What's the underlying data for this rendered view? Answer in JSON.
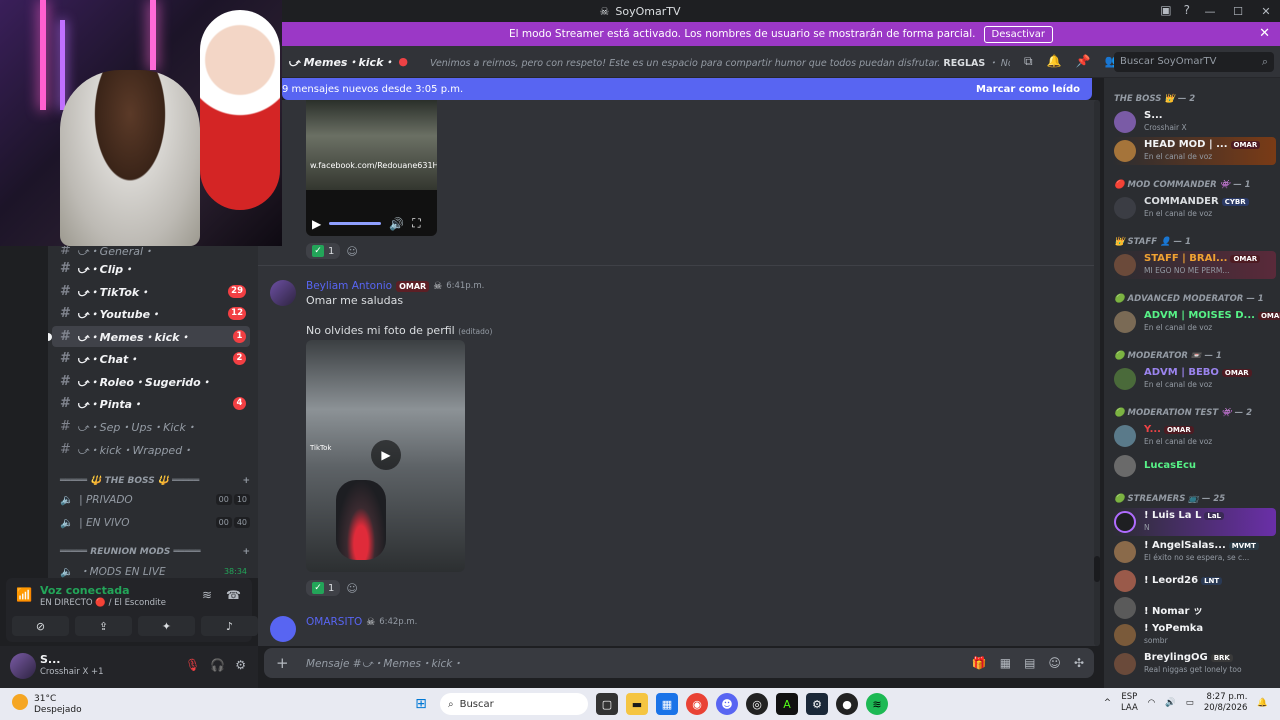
{
  "titlebar": {
    "title": "SoyOmarTV"
  },
  "banner": {
    "text": "El modo Streamer está activado. Los nombres de usuario se mostrarán de forma parcial.",
    "button": "Desactivar"
  },
  "channel": {
    "name": "⤻ Memes・kick・",
    "topic": "Venimos a reirnos, pero con respeto! Este es un espacio para compartir humor que todos puedan disfrutar.",
    "topic_bold": "REGLAS",
    "topic_tail": "・ No envíes memes que ...",
    "search_placeholder": "Buscar SoyOmarTV"
  },
  "newbar": {
    "text": "9 mensajes nuevos desde 3:05 p.m.",
    "action": "Marcar como leído"
  },
  "sidebar": {
    "channels": [
      {
        "label": "⤻・General・",
        "badge": "",
        "style": "muted"
      },
      {
        "label": "⤻・Clip・",
        "badge": "",
        "style": "bold"
      },
      {
        "label": "⤻・TikTok・",
        "badge": "29",
        "style": "bold"
      },
      {
        "label": "⤻・Youtube・",
        "badge": "12",
        "style": "bold"
      },
      {
        "label": "⤻・Memes・kick・",
        "badge": "1",
        "style": "selected"
      },
      {
        "label": "⤻・Chat・",
        "badge": "2",
        "style": "bold"
      },
      {
        "label": "⤻・Roleo・Sugerido・",
        "badge": "",
        "style": "bold"
      },
      {
        "label": "⤻・Pinta・",
        "badge": "4",
        "style": "bold"
      },
      {
        "label": "⤻・Sep・Ups・Kick・",
        "badge": "",
        "style": "muted"
      },
      {
        "label": "⤻・kick・Wrapped・",
        "badge": "",
        "style": "muted"
      }
    ],
    "category_boss": "═════ 🔱 THE BOSS 🔱 ═════",
    "voice_boss": [
      {
        "label": "| PRIVADO",
        "a": "00",
        "b": "10"
      },
      {
        "label": "| EN VIVO",
        "a": "00",
        "b": "40"
      }
    ],
    "category_reunion": "═════ REUNION MODS ═════",
    "voice_reunion": {
      "label": "・MODS EN LIVE",
      "time": "38:34"
    }
  },
  "voice_panel": {
    "status": "Voz conectada",
    "sub": "EN DIRECTO 🔴 / El Escondite"
  },
  "user_panel": {
    "name": "S...",
    "status": "Crosshair X +1"
  },
  "messages": {
    "m1_reactions": {
      "count": "1"
    },
    "m1_url": "w.facebook.com/Redouane631H",
    "m2": {
      "author": "Beyliam Antonio",
      "tag": "OMAR",
      "time": "6:41p.m.",
      "line1": "Omar me saludas",
      "line2": "No olvides mi foto de perfil",
      "edited": "(editado)",
      "video_label": "TikTok"
    },
    "m2_reactions": {
      "count": "1"
    },
    "m3": {
      "author": "OMARSITO",
      "time": "6:42p.m."
    }
  },
  "input": {
    "placeholder": "Mensaje #⤻・Memes・kick・"
  },
  "members": {
    "groups": [
      {
        "title": "THE BOSS 👑 — 2"
      },
      {
        "title": "🔴 MOD COMMANDER 👾 — 1"
      },
      {
        "title": "👑 STAFF 👤 — 1"
      },
      {
        "title": "🟢 ADVANCED MODERATOR — 1"
      },
      {
        "title": "🟢 MODERATOR 📼 — 1"
      },
      {
        "title": "🟢 MODERATION TEST 👾 — 2"
      },
      {
        "title": "🟢 STREAMERS 📺 — 25"
      }
    ],
    "list": [
      {
        "name": "S...",
        "sub": "Crosshair X",
        "tag": "",
        "color": "#f2f3f5"
      },
      {
        "name": "HEAD MOD | ...",
        "sub": "En el canal de voz",
        "tag": "OMAR",
        "color": "#f2f3f5"
      },
      {
        "name": "COMMANDER",
        "sub": "En el canal de voz",
        "tag": "CYBR",
        "color": "#dbdee1"
      },
      {
        "name": "STAFF | BRAI...",
        "sub": "MI EGO NO ME PERM...",
        "tag": "OMAR",
        "color": "#f0a232"
      },
      {
        "name": "ADVM | MOISES D...",
        "sub": "En el canal de voz",
        "tag": "OMAR",
        "color": "#57f287"
      },
      {
        "name": "ADVM | BEBO",
        "sub": "En el canal de voz",
        "tag": "OMAR",
        "color": "#9b84ee"
      },
      {
        "name": "Y...",
        "sub": "En el canal de voz",
        "tag": "OMAR",
        "color": "#ed4245"
      },
      {
        "name": "LucasEcu",
        "sub": "",
        "tag": "",
        "color": "#57f287"
      },
      {
        "name": "! Luis La L",
        "sub": "N",
        "tag": "LaL",
        "color": "#f2f3f5"
      },
      {
        "name": "! AngelSalas...",
        "sub": "El éxito no se espera, se c...",
        "tag": "MVMT",
        "color": "#f2f3f5"
      },
      {
        "name": "! Leord26",
        "sub": "",
        "tag": "LNT",
        "color": "#f2f3f5"
      },
      {
        "name": "! Nomar ッ",
        "sub": "",
        "tag": "",
        "color": "#f2f3f5"
      },
      {
        "name": "! YoPemka",
        "sub": "sombr",
        "tag": "",
        "color": "#f2f3f5"
      },
      {
        "name": "BreylingOG",
        "sub": "Real niggas get lonely too",
        "tag": "BRK",
        "color": "#f2f3f5"
      }
    ]
  },
  "taskbar": {
    "temp": "31°C",
    "weather": "Despejado",
    "search": "Buscar",
    "lang1": "ESP",
    "lang2": "LAA",
    "time": "8:27 p.m.",
    "date": "20/8/2026"
  }
}
